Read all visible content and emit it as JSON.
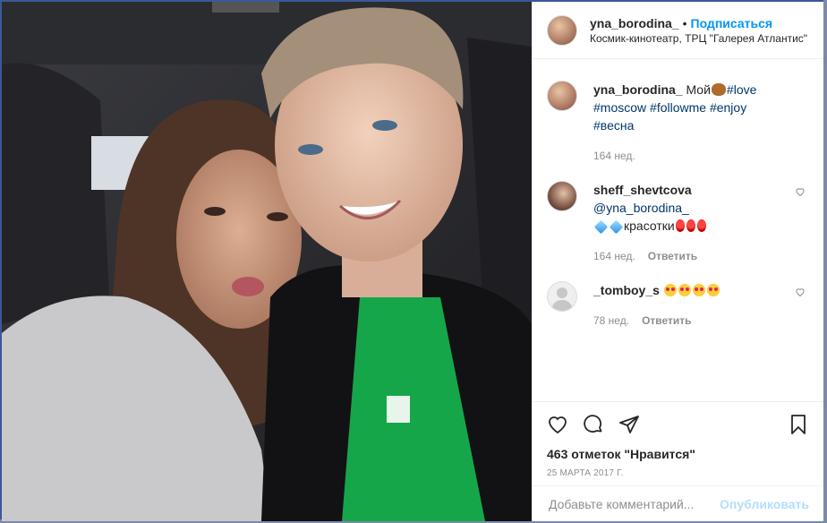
{
  "header": {
    "username": "yna_borodina_",
    "separator": "•",
    "follow_label": "Подписаться",
    "location": "Космик-кинотеатр, ТРЦ \"Галерея Атлантис\""
  },
  "caption": {
    "username": "yna_borodina_",
    "text": "Мой",
    "hashtags": [
      "#love",
      "#moscow",
      "#followme",
      "#enjoy",
      "#весна"
    ],
    "time": "164 нед."
  },
  "comments": [
    {
      "username": "sheff_shevtcova",
      "mention": "@yna_borodina_",
      "text": "красотки",
      "time": "164 нед.",
      "reply_label": "Ответить"
    },
    {
      "username": "_tomboy_s",
      "time": "78 нед.",
      "reply_label": "Ответить"
    }
  ],
  "actions": {
    "likes_text": "463 отметок \"Нравится\"",
    "date": "25 МАРТА 2017 Г."
  },
  "add_comment": {
    "placeholder": "Добавьте комментарий...",
    "publish_label": "Опубликовать"
  },
  "colors": {
    "accent": "#0095f6",
    "tag": "#00376b",
    "border": "#3b5998"
  }
}
